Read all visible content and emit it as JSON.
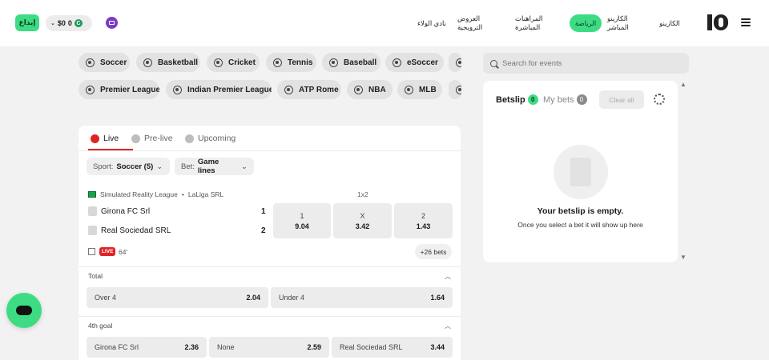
{
  "header": {
    "deposit_label": "إيداع",
    "balance_amount": "$0",
    "balance_chevron": "⌄",
    "coin_amount": "0",
    "coin_symbol": "C",
    "nav": [
      {
        "label": "الكازينو"
      },
      {
        "label": "الكازينو المباشر"
      },
      {
        "label": "الرياضة",
        "active": true
      },
      {
        "label": "المراهنات المباشرة"
      },
      {
        "label": "العروض الترويجية"
      },
      {
        "label": "نادي الولاء"
      }
    ],
    "logo_text": "10"
  },
  "sports": [
    {
      "label": "Soccer"
    },
    {
      "label": "Basketball"
    },
    {
      "label": "Cricket"
    },
    {
      "label": "Tennis"
    },
    {
      "label": "Baseball"
    },
    {
      "label": "eSoccer"
    }
  ],
  "leagues": [
    {
      "label": "Premier League"
    },
    {
      "label": "Indian Premier League"
    },
    {
      "label": "ATP Rome"
    },
    {
      "label": "NBA"
    },
    {
      "label": "MLB"
    }
  ],
  "tabs": [
    {
      "label": "Live"
    },
    {
      "label": "Pre-live"
    },
    {
      "label": "Upcoming"
    }
  ],
  "filters": {
    "sport_label": "Sport:",
    "sport_value": "Soccer (5)",
    "bet_label": "Bet:",
    "bet_value": "Game lines"
  },
  "match": {
    "competition": "Simulated Reality League",
    "separator": "•",
    "league": "LaLiga SRL",
    "market": "1x2",
    "home": {
      "name": "Girona FC Srl",
      "score": "1"
    },
    "away": {
      "name": "Real Sociedad SRL",
      "score": "2"
    },
    "odds": [
      {
        "label": "1",
        "value": "9.04"
      },
      {
        "label": "X",
        "value": "3.42"
      },
      {
        "label": "2",
        "value": "1.43"
      }
    ],
    "live_badge": "LIVE",
    "minute": "64'",
    "more_bets": "+26 bets"
  },
  "total_market": {
    "title": "Total",
    "options": [
      {
        "label": "Over 4",
        "value": "2.04"
      },
      {
        "label": "Under 4",
        "value": "1.64"
      }
    ]
  },
  "goal_market": {
    "title": "4th goal",
    "options": [
      {
        "label": "Girona FC Srl",
        "value": "2.36"
      },
      {
        "label": "None",
        "value": "2.59"
      },
      {
        "label": "Real Sociedad SRL",
        "value": "3.44"
      }
    ]
  },
  "search": {
    "placeholder": "Search for events"
  },
  "betslip": {
    "tab_betslip": "Betslip",
    "betslip_count": "0",
    "tab_mybets": "My bets",
    "mybets_count": "0",
    "clear_all": "Clear all",
    "empty_title": "Your betslip is empty.",
    "empty_sub": "Once you select a bet it will show up here"
  },
  "colors": {
    "accent": "#3ddc84",
    "live": "#e02424"
  }
}
